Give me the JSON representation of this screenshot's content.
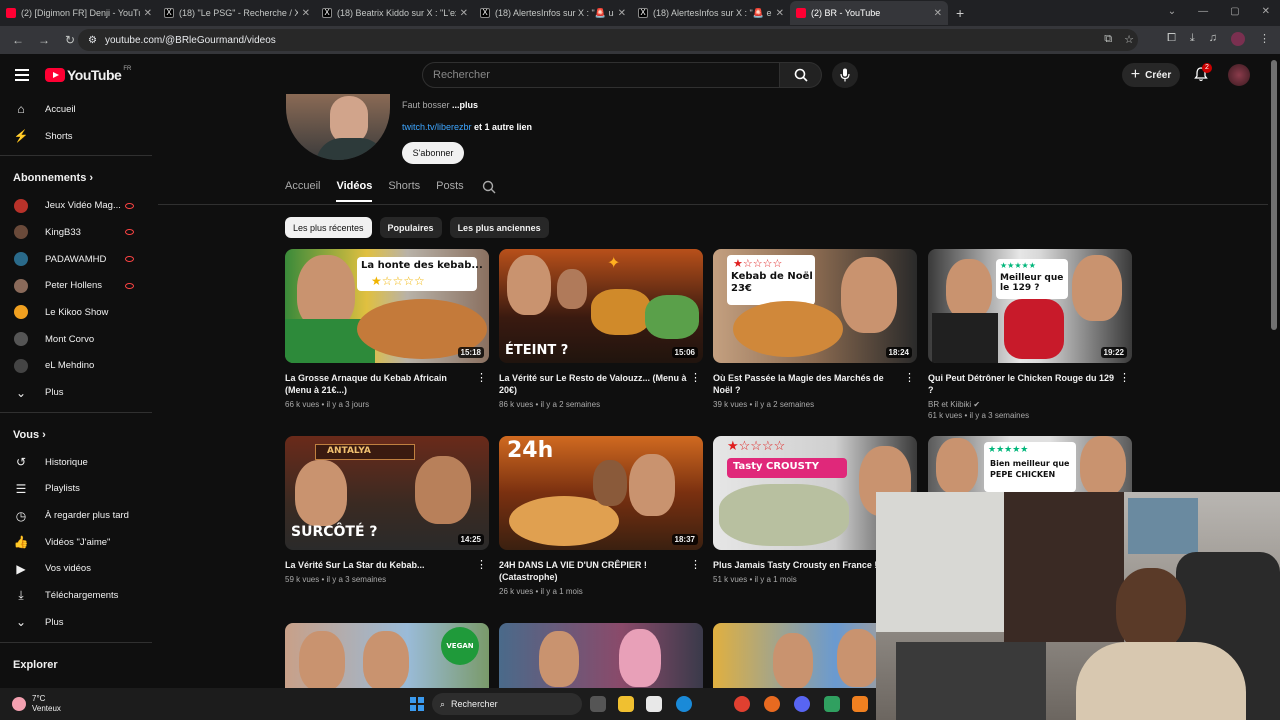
{
  "browser": {
    "tabs": [
      {
        "title": "(2) [Digimon FR] Denji - YouTube",
        "icon": "youtube-icon",
        "active": false
      },
      {
        "title": "(18) \"Le PSG\" - Recherche / X",
        "icon": "x-icon",
        "active": false
      },
      {
        "title": "(18) Beatrix Kiddo sur X : \"L'extr",
        "icon": "x-icon",
        "active": false
      },
      {
        "title": "(18) AlertesInfos sur X : \"🚨 us",
        "icon": "x-icon",
        "active": false
      },
      {
        "title": "(18) AlertesInfos sur X : \"🚨 en F",
        "icon": "x-icon",
        "active": false
      },
      {
        "title": "(2) BR - YouTube",
        "icon": "youtube-icon",
        "active": true
      }
    ],
    "url": "youtube.com/@BRleGourmand/videos"
  },
  "header": {
    "logo_text": "YouTube",
    "region": "FR",
    "search_placeholder": "Rechercher",
    "create_label": "Créer",
    "notification_count": "2"
  },
  "sidebar": {
    "main": [
      {
        "label": "Accueil",
        "icon": "home-icon"
      },
      {
        "label": "Shorts",
        "icon": "shorts-icon"
      }
    ],
    "subscriptions_title": "Abonnements",
    "subscriptions": [
      {
        "label": "Jeux Vidéo Mag...",
        "live": true,
        "color": "#b8322a"
      },
      {
        "label": "KingB33",
        "live": true,
        "color": "#6a4a3a"
      },
      {
        "label": "PADAWAMHD",
        "live": true,
        "color": "#2a6a8a"
      },
      {
        "label": "Peter Hollens",
        "live": true,
        "color": "#8a6a5a"
      },
      {
        "label": "Le Kikoo Show",
        "live": false,
        "color": "#f0a020"
      },
      {
        "label": "Mont Corvo",
        "live": false,
        "color": "#555555"
      },
      {
        "label": "eL Mehdino",
        "live": false,
        "color": "#444444"
      },
      {
        "label": "Plus",
        "live": false,
        "color": ""
      }
    ],
    "you_title": "Vous",
    "you_items": [
      {
        "label": "Historique",
        "icon": "history-icon"
      },
      {
        "label": "Playlists",
        "icon": "playlists-icon"
      },
      {
        "label": "À regarder plus tard",
        "icon": "watch-later-icon"
      },
      {
        "label": "Vidéos \"J'aime\"",
        "icon": "like-icon"
      },
      {
        "label": "Vos vidéos",
        "icon": "your-videos-icon"
      },
      {
        "label": "Téléchargements",
        "icon": "download-icon"
      },
      {
        "label": "Plus",
        "icon": "chevron-down-icon"
      }
    ],
    "explore_title": "Explorer"
  },
  "channel": {
    "description_prefix": "Faut bosser ",
    "description_more": "...plus",
    "link": "twitch.tv/liberezbr",
    "link_suffix": " et 1 autre lien",
    "subscribe_label": "S'abonner",
    "tabs": [
      "Accueil",
      "Vidéos",
      "Shorts",
      "Posts"
    ],
    "active_tab": "Vidéos"
  },
  "filters": [
    {
      "label": "Les plus récentes",
      "active": true
    },
    {
      "label": "Populaires",
      "active": false
    },
    {
      "label": "Les plus anciennes",
      "active": false
    }
  ],
  "videos": [
    {
      "title": "La Grosse Arnaque du Kebab Africain (Menu à 21€...)",
      "views": "66 k vues",
      "age": "il y a 3 jours",
      "duration": "15:18",
      "thumb_text": "La honte des kebab...",
      "channel": ""
    },
    {
      "title": "La Vérité sur Le Resto de Valouzz... (Menu à 20€)",
      "views": "86 k vues",
      "age": "il y a 2 semaines",
      "duration": "15:06",
      "thumb_text": "ÉTEINT ?",
      "channel": ""
    },
    {
      "title": "Où Est Passée la Magie des Marchés de Noël ?",
      "views": "39 k vues",
      "age": "il y a 2 semaines",
      "duration": "18:24",
      "thumb_text": "Kebab de Noël 23€",
      "channel": ""
    },
    {
      "title": "Qui Peut Détrôner le Chicken Rouge du 129 ?",
      "views": "61 k vues",
      "age": "il y a 3 semaines",
      "duration": "19:22",
      "thumb_text": "Meilleur que le 129 ?",
      "channel": "BR et Kiibiki"
    },
    {
      "title": "La Vérité Sur La Star du Kebab...",
      "views": "59 k vues",
      "age": "il y a 3 semaines",
      "duration": "14:25",
      "thumb_text": "SURCÔTÉ ?",
      "channel": ""
    },
    {
      "title": "24H DANS LA VIE D'UN CRÊPIER ! (Catastrophe)",
      "views": "26 k vues",
      "age": "il y a 1 mois",
      "duration": "18:37",
      "thumb_text": "24h",
      "channel": ""
    },
    {
      "title": "Plus Jamais Tasty Crousty en France !",
      "views": "51 k vues",
      "age": "il y a 1 mois",
      "duration": "",
      "thumb_text": "Tasty CROUSTY",
      "channel": ""
    },
    {
      "title": "",
      "views": "",
      "age": "",
      "duration": "",
      "thumb_text": "Bien meilleur que PEPE CHICKEN",
      "channel": ""
    }
  ],
  "row3_badge": "VEGAN",
  "taskbar": {
    "temperature": "7°C",
    "weather": "Venteux",
    "search_label": "Rechercher"
  },
  "colors": {
    "background": "#0f0f0f",
    "accent_red": "#ff0033",
    "link_blue": "#3ea6ff"
  }
}
